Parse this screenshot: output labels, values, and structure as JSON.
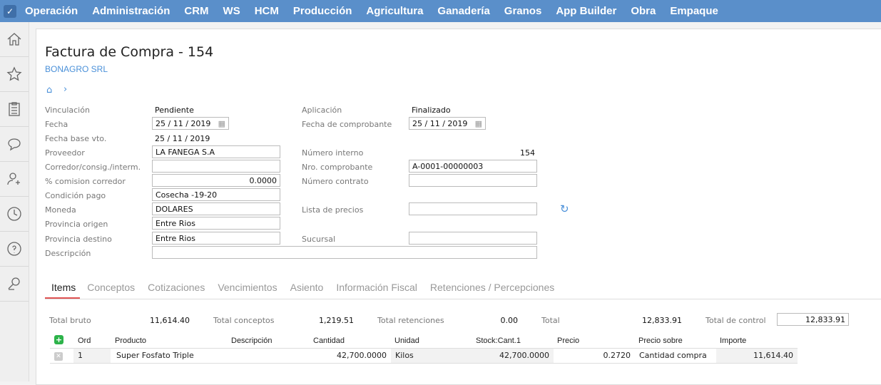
{
  "topbar": {
    "menu": [
      "Operación",
      "Administración",
      "CRM",
      "WS",
      "HCM",
      "Producción",
      "Agricultura",
      "Ganadería",
      "Granos",
      "App Builder",
      "Obra",
      "Empaque"
    ]
  },
  "sidebar": {
    "icons": [
      "home-icon",
      "star-icon",
      "clipboard-icon",
      "chat-icon",
      "add-user-icon",
      "clock-icon",
      "help-icon",
      "search-user-icon"
    ]
  },
  "header": {
    "title": "Factura de Compra - 154",
    "company": "BONAGRO SRL"
  },
  "form": {
    "vinculacion_label": "Vinculación",
    "vinculacion": "Pendiente",
    "aplicacion_label": "Aplicación",
    "aplicacion": "Finalizado",
    "fecha_label": "Fecha",
    "fecha": "25 / 11 / 2019",
    "fecha_comp_label": "Fecha de comprobante",
    "fecha_comp": "25 / 11 / 2019",
    "fecha_vto_label": "Fecha base vto.",
    "fecha_vto": "25 / 11 / 2019",
    "proveedor_label": "Proveedor",
    "proveedor": "LA FANEGA S.A",
    "num_interno_label": "Número interno",
    "num_interno": "154",
    "corredor_label": "Corredor/consig./interm.",
    "corredor": "",
    "nro_comp_label": "Nro. comprobante",
    "nro_comp": "A-0001-00000003",
    "comision_label": "% comision corredor",
    "comision": "0.0000",
    "num_contrato_label": "Número contrato",
    "num_contrato": "",
    "condicion_label": "Condición pago",
    "condicion": "Cosecha -19-20",
    "moneda_label": "Moneda",
    "moneda": "DOLARES",
    "lista_label": "Lista de precios",
    "lista": "",
    "prov_origen_label": "Provincia origen",
    "prov_origen": "Entre Rios",
    "prov_destino_label": "Provincia destino",
    "prov_destino": "Entre Rios",
    "sucursal_label": "Sucursal",
    "sucursal": "",
    "descripcion_label": "Descripción",
    "descripcion": ""
  },
  "tabs": [
    "Items",
    "Conceptos",
    "Cotizaciones",
    "Vencimientos",
    "Asiento",
    "Información Fiscal",
    "Retenciones / Percepciones"
  ],
  "totals": {
    "bruto_label": "Total bruto",
    "bruto": "11,614.40",
    "conceptos_label": "Total conceptos",
    "conceptos": "1,219.51",
    "retenciones_label": "Total retenciones",
    "retenciones": "0.00",
    "total_label": "Total",
    "total": "12,833.91",
    "control_label": "Total de control",
    "control": "12,833.91"
  },
  "table": {
    "headers": [
      "Ord",
      "Producto",
      "Descripción",
      "Cantidad",
      "Unidad",
      "Stock:Cant.1",
      "Precio",
      "Precio sobre",
      "Importe"
    ],
    "rows": [
      {
        "ord": "1",
        "producto": "Super Fosfato Triple",
        "descripcion": "",
        "cantidad": "42,700.0000",
        "unidad": "Kilos",
        "stock": "42,700.0000",
        "precio": "0.2720",
        "precio_sobre": "Cantidad compra",
        "importe": "11,614.40"
      }
    ]
  },
  "colors": {
    "topbar": "#5a8fca",
    "link": "#4a90d9",
    "tab_active": "#e05252",
    "add": "#2db34a"
  }
}
